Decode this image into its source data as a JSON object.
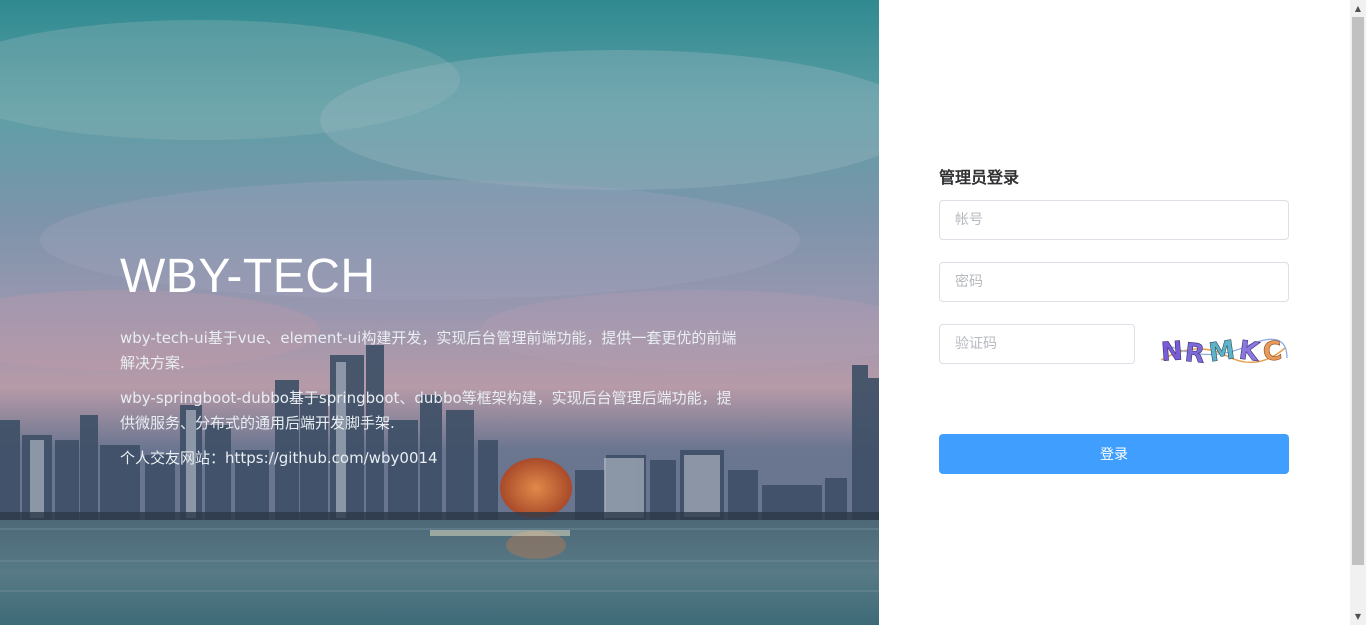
{
  "hero": {
    "title": "WBY-TECH",
    "lines": [
      "wby-tech-ui基于vue、element-ui构建开发，实现后台管理前端功能，提供一套更优的前端解决方案.",
      "wby-springboot-dubbo基于springboot、dubbo等框架构建，实现后台管理后端功能，提供微服务、分布式的通用后端开发脚手架.",
      "个人交友网站：https://github.com/wby0014"
    ]
  },
  "login": {
    "title": "管理员登录",
    "username_placeholder": "帐号",
    "password_placeholder": "密码",
    "code_placeholder": "验证码",
    "captcha_text": "NRMKC",
    "button_label": "登录"
  },
  "colors": {
    "primary": "#409eff",
    "border": "#dcdfe6",
    "title": "#303133"
  },
  "icons": {
    "scroll_up": "triangle-up-icon",
    "scroll_down": "triangle-down-icon"
  }
}
